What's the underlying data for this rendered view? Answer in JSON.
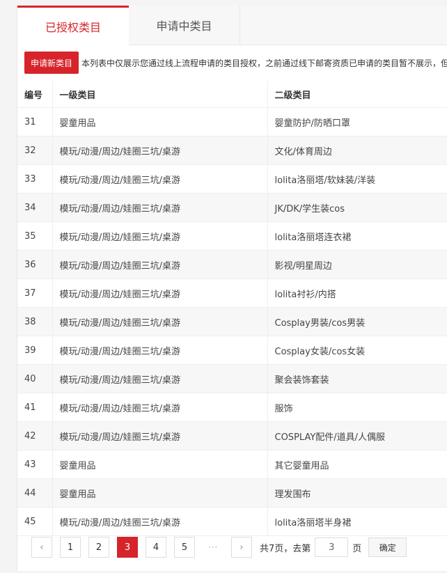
{
  "tabs": {
    "authorized": "已授权类目",
    "applying": "申请中类目"
  },
  "toolbar": {
    "apply_label": "申请新类目",
    "notice": "本列表中仅展示您通过线上流程申请的类目授权，之前通过线下邮寄资质已申请的类目暂不展示，但"
  },
  "table": {
    "headers": [
      "编号",
      "一级类目",
      "二级类目"
    ],
    "rows": [
      [
        "31",
        "婴童用品",
        "婴童防护/防晒口罩"
      ],
      [
        "32",
        "模玩/动漫/周边/娃圈三坑/桌游",
        "文化/体育周边"
      ],
      [
        "33",
        "模玩/动漫/周边/娃圈三坑/桌游",
        "lolita洛丽塔/软妹装/洋装"
      ],
      [
        "34",
        "模玩/动漫/周边/娃圈三坑/桌游",
        "JK/DK/学生装cos"
      ],
      [
        "35",
        "模玩/动漫/周边/娃圈三坑/桌游",
        "lolita洛丽塔连衣裙"
      ],
      [
        "36",
        "模玩/动漫/周边/娃圈三坑/桌游",
        "影视/明星周边"
      ],
      [
        "37",
        "模玩/动漫/周边/娃圈三坑/桌游",
        "lolita衬衫/内搭"
      ],
      [
        "38",
        "模玩/动漫/周边/娃圈三坑/桌游",
        "Cosplay男装/cos男装"
      ],
      [
        "39",
        "模玩/动漫/周边/娃圈三坑/桌游",
        "Cosplay女装/cos女装"
      ],
      [
        "40",
        "模玩/动漫/周边/娃圈三坑/桌游",
        "聚会装饰套装"
      ],
      [
        "41",
        "模玩/动漫/周边/娃圈三坑/桌游",
        "服饰"
      ],
      [
        "42",
        "模玩/动漫/周边/娃圈三坑/桌游",
        "COSPLAY配件/道具/人偶服"
      ],
      [
        "43",
        "婴童用品",
        "其它婴童用品"
      ],
      [
        "44",
        "婴童用品",
        "理发围布"
      ],
      [
        "45",
        "模玩/动漫/周边/娃圈三坑/桌游",
        "lolita洛丽塔半身裙"
      ]
    ]
  },
  "pagination": {
    "prev_icon": "chevron-left-icon",
    "next_icon": "chevron-right-icon",
    "prev_glyph": "‹",
    "next_glyph": "›",
    "pages": [
      "1",
      "2",
      "3",
      "4",
      "5"
    ],
    "current": "3",
    "ellipsis": "···",
    "total_text": "共7页，去第",
    "goto_value": "3",
    "page_suffix": "页",
    "confirm_label": "确定"
  },
  "colors": {
    "accent": "#d6242a"
  }
}
